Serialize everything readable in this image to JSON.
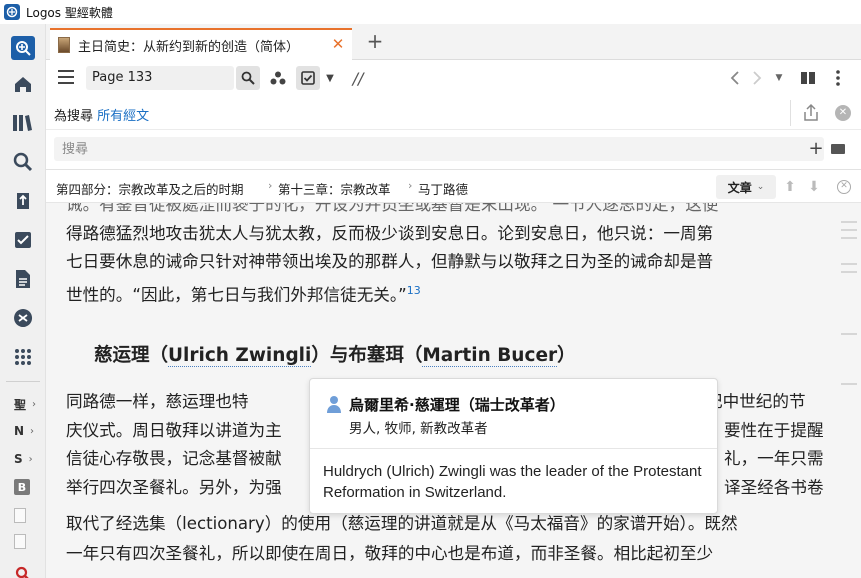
{
  "window": {
    "title": "Logos 聖經軟體"
  },
  "tab": {
    "label": "主日简史：从新约到新的创造（简体）",
    "close": "✕",
    "add": "+"
  },
  "toolbar": {
    "reference": "Page 133",
    "slash": "//"
  },
  "search_in": {
    "prefix": "為搜尋",
    "scope": "所有經文"
  },
  "search": {
    "placeholder": "搜尋"
  },
  "breadcrumb": {
    "items": [
      "第四部分：宗教改革及之后的时期",
      "第十三章：宗教改革",
      "马丁路德"
    ],
    "separator": "›",
    "article_label": "文章"
  },
  "sidebar": {
    "resources": [
      {
        "label": "聖",
        "type": "text"
      },
      {
        "label": "N",
        "type": "text"
      },
      {
        "label": "S",
        "type": "text"
      },
      {
        "label": "B",
        "type": "badge"
      },
      {
        "label": "",
        "type": "doc"
      },
      {
        "label": "",
        "type": "doc"
      }
    ]
  },
  "content": {
    "lines_top": [
      "诫。有鉴音從被處涩而亵于的化，开设为并员坐或基督是末山现。    一节人逐思的定，这便",
      "得路德猛烈地攻击犹太人与犹太教，反而极少谈到安息日。论到安息日，他只说：一周第",
      "七日要休息的诫命只针对神带领出埃及的那群人，但静默与以敬拜之日为圣的诫命却是普",
      "世性的。“因此，第七日与我们外邦信徒无关。”"
    ],
    "footnote": "13",
    "heading_cn1": "慈运理（",
    "heading_en1": "Ulrich Zwingli",
    "heading_cn2": "）与布塞珥（",
    "heading_en2": "Martin Bucer",
    "heading_cn3": "）",
    "lines_bottom_left": [
      "    同路德一样，慈运理也特",
      "庆仪式。周日敬拜以讲道为主",
      "信徒心存敬畏，记念基督被献",
      "举行四次圣餐礼。另外，为强"
    ],
    "lines_bottom_right": [
      "纪中世纪的节",
      "要性在于提醒",
      "礼，一年只需",
      "译圣经各书卷"
    ],
    "lines_bottom_full": [
      "取代了经选集（lectionary）的使用（慈运理的讲道就是从《马太福音》的家谱开始）。既然",
      "一年只有四次圣餐礼，所以即使在周日，敬拜的中心也是布道，而非圣餐。相比起初至少"
    ]
  },
  "popup": {
    "title": "烏爾里希·慈運理（瑞士改革者）",
    "subtitle": "男人, 牧师, 新教改革者",
    "description": "Huldrych (Ulrich) Zwingli was the leader of the Protestant Reformation in Switzerland."
  },
  "colors": {
    "accent": "#e8722c",
    "link": "#1a6fc4",
    "logo": "#1d5fa8"
  }
}
